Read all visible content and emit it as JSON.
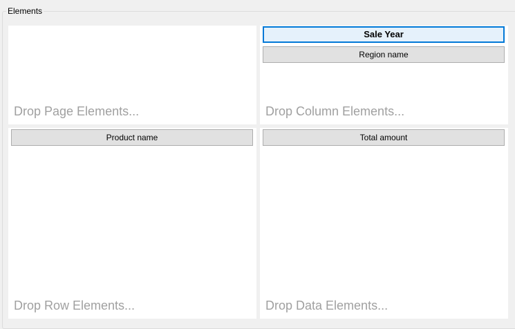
{
  "group": {
    "title": "Elements"
  },
  "panels": {
    "page": {
      "hint": "Drop Page Elements...",
      "fields": []
    },
    "column": {
      "hint": "Drop Column Elements...",
      "fields": [
        "Sale Year",
        "Region name"
      ],
      "selected": "Sale Year"
    },
    "row": {
      "hint": "Drop Row Elements...",
      "fields": [
        "Product name"
      ]
    },
    "data": {
      "hint": "Drop Data Elements...",
      "fields": [
        "Total amount"
      ]
    }
  },
  "colors": {
    "background": "#f0f0f0",
    "panel": "#ffffff",
    "button_face": "#e1e1e1",
    "selected_border": "#0078d7",
    "hint_text": "#a0a0a0"
  }
}
